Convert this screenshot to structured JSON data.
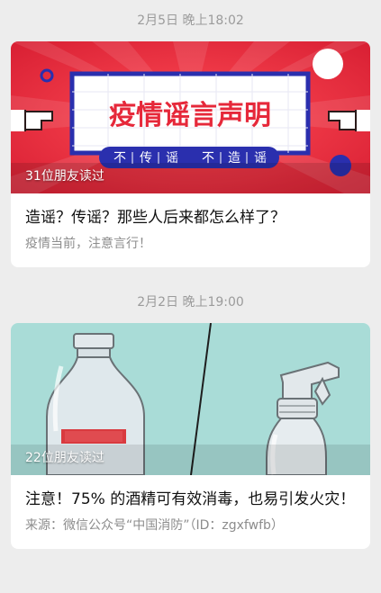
{
  "messages": [
    {
      "time": "2月5日 晚上18:02",
      "readers": "31位朋友读过",
      "title": "造谣？传谣？那些人后来都怎么样了？",
      "desc": "疫情当前，注意言行！",
      "cover": {
        "headline": "疫情谣言声明",
        "slogan_chars": [
          "不",
          "传",
          "谣",
          "不",
          "造",
          "谣"
        ],
        "colors": {
          "bg": "#e6283a",
          "blue": "#2a2fae",
          "white": "#ffffff"
        }
      }
    },
    {
      "time": "2月2日 晚上19:00",
      "readers": "22位朋友读过",
      "title": "注意！75% 的酒精可有效消毒，也易引发火灾！",
      "desc": "来源：微信公众号“中国消防”（ID：zgxfwfb）",
      "cover": {
        "colors": {
          "bg": "#a9dcd7",
          "bottle": "#dfe8ec",
          "label": "#d93a3f"
        }
      }
    }
  ]
}
